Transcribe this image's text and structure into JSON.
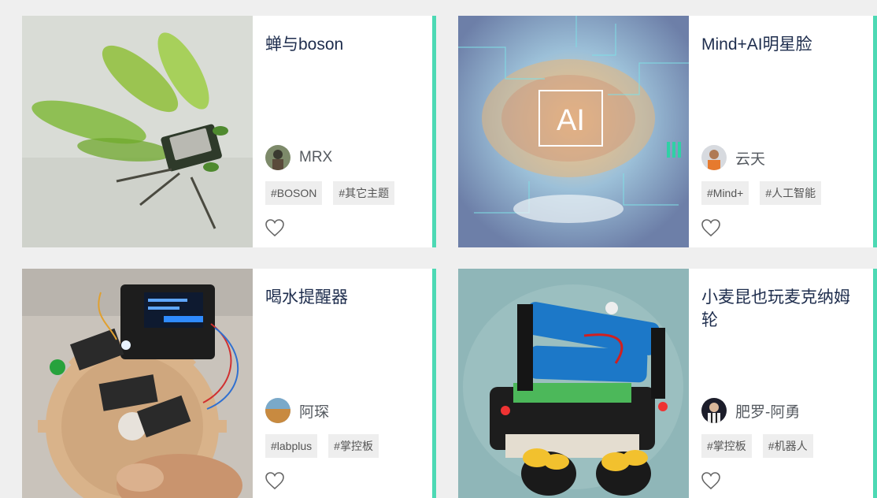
{
  "cards": [
    {
      "title": "蝉与boson",
      "author": "MRX",
      "tags": [
        "#BOSON",
        "#其它主题"
      ],
      "like_icon": "heart-outline-icon"
    },
    {
      "title": "Mind+AI明星脸",
      "author": "云天",
      "tags": [
        "#Mind+",
        "#人工智能"
      ],
      "like_icon": "heart-outline-icon"
    },
    {
      "title": "喝水提醒器",
      "author": "阿琛",
      "tags": [
        "#labplus",
        "#掌控板"
      ],
      "like_icon": "heart-outline-icon"
    },
    {
      "title": "小麦昆也玩麦克纳姆轮",
      "author": "肥罗-阿勇",
      "tags": [
        "#掌控板",
        "#机器人"
      ],
      "like_icon": "heart-outline-icon"
    }
  ],
  "colors": {
    "accent": "#4dd9b4",
    "title": "#1e2d4d",
    "tag_bg": "#eeeeee"
  },
  "thumb_text": {
    "ai_label": "AI"
  }
}
